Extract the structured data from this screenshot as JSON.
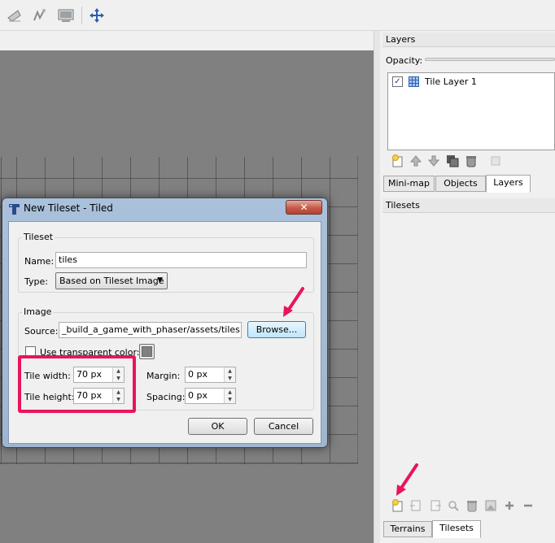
{
  "toolbar": {
    "tools": [
      {
        "icon": "eraser-icon"
      },
      {
        "icon": "select-region-icon"
      },
      {
        "icon": "image-layer-icon"
      },
      {
        "icon": "move-icon"
      }
    ]
  },
  "layers_panel": {
    "title": "Layers",
    "opacity_label": "Opacity:",
    "layers": [
      {
        "name": "Tile Layer 1",
        "visible": true,
        "icon": "tile-layer-icon"
      }
    ],
    "actions": [
      "new-layer-icon",
      "move-layer-up-icon",
      "move-layer-down-icon",
      "duplicate-layer-icon",
      "delete-layer-icon",
      "layer-properties-icon"
    ]
  },
  "dock_tabs": [
    {
      "label": "Mini-map",
      "active": false
    },
    {
      "label": "Objects",
      "active": false
    },
    {
      "label": "Layers",
      "active": true
    }
  ],
  "tilesets_panel": {
    "title": "Tilesets",
    "actions": [
      "new-tileset-icon",
      "import-tileset-icon",
      "export-tileset-icon",
      "edit-tileset-icon",
      "delete-tileset-icon",
      "tileset-image-icon",
      "add-tiles-icon",
      "remove-tiles-icon"
    ]
  },
  "bottom_tabs": [
    {
      "label": "Terrains",
      "active": false
    },
    {
      "label": "Tilesets",
      "active": true
    }
  ],
  "dialog": {
    "title": "New Tileset - Tiled",
    "close_label": "✕",
    "tileset_group": "Tileset",
    "name_label": "Name:",
    "name_value": "tiles",
    "type_label": "Type:",
    "type_value": "Based on Tileset Image",
    "image_group": "Image",
    "source_label": "Source:",
    "source_value": "_build_a_game_with_phaser/assets/tiles.png",
    "browse_label": "Browse...",
    "transparent_label": "Use transparent color:",
    "transparent_checked": false,
    "transparent_color": "#808080",
    "tile_width_label": "Tile width:",
    "tile_width_value": "70 px",
    "tile_height_label": "Tile height:",
    "tile_height_value": "70 px",
    "margin_label": "Margin:",
    "margin_value": "0 px",
    "spacing_label": "Spacing:",
    "spacing_value": "0 px",
    "ok_label": "OK",
    "cancel_label": "Cancel"
  },
  "colors": {
    "canvas": "#808080",
    "annotation": "#e8155a",
    "dialog_frame": "#aac1db"
  }
}
